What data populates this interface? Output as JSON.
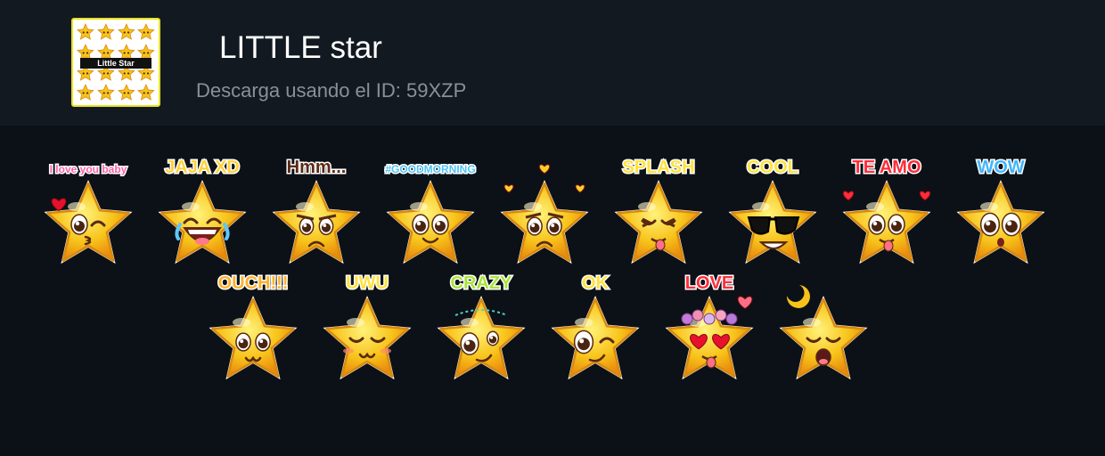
{
  "pack": {
    "thumbnail_label": "Little Star",
    "title": "LITTLE star",
    "id_text": "Descarga usando el ID: 59XZP"
  },
  "colors": {
    "header_bg": "#121921",
    "page_bg": "#0c1117",
    "thumbnail_border": "#e9e21f",
    "star_fill": "#f7c31a",
    "star_outline": "#d88a10"
  },
  "stickers": [
    {
      "caption": "I love you baby",
      "expression": "kiss-heart",
      "caption_color": "#ff5fa8"
    },
    {
      "caption": "JAJA XD",
      "expression": "laughing-tears",
      "caption_color": "#ffd23c"
    },
    {
      "caption": "Hmm...",
      "expression": "suspicious",
      "caption_color": "#5a2a16"
    },
    {
      "caption": "#GOODMORNING",
      "expression": "smile-sun",
      "caption_color": "#4fc3f7"
    },
    {
      "caption": "",
      "expression": "sad-hearts",
      "caption_color": "#ffd23c"
    },
    {
      "caption": "SPLASH",
      "expression": "tongue-out",
      "caption_color": "#ffe23c"
    },
    {
      "caption": "COOL",
      "expression": "sunglasses",
      "caption_color": "#ffe23c"
    },
    {
      "caption": "TE AMO",
      "expression": "love-smile",
      "caption_color": "#ff2d3b"
    },
    {
      "caption": "WOW",
      "expression": "surprised",
      "caption_color": "#3fb6ff"
    },
    {
      "caption": "OUCH!!!",
      "expression": "ouch",
      "caption_color": "#ffb12c"
    },
    {
      "caption": "UWU",
      "expression": "uwu",
      "caption_color": "#ffe23c"
    },
    {
      "caption": "CRAZY",
      "expression": "crazy",
      "caption_color": "#a8e43c"
    },
    {
      "caption": "OK",
      "expression": "wink",
      "caption_color": "#ffe23c"
    },
    {
      "caption": "LOVE",
      "expression": "heart-eyes",
      "caption_color": "#ff2d3b"
    },
    {
      "caption": "",
      "expression": "sleeping",
      "caption_color": "#ffe23c"
    }
  ]
}
